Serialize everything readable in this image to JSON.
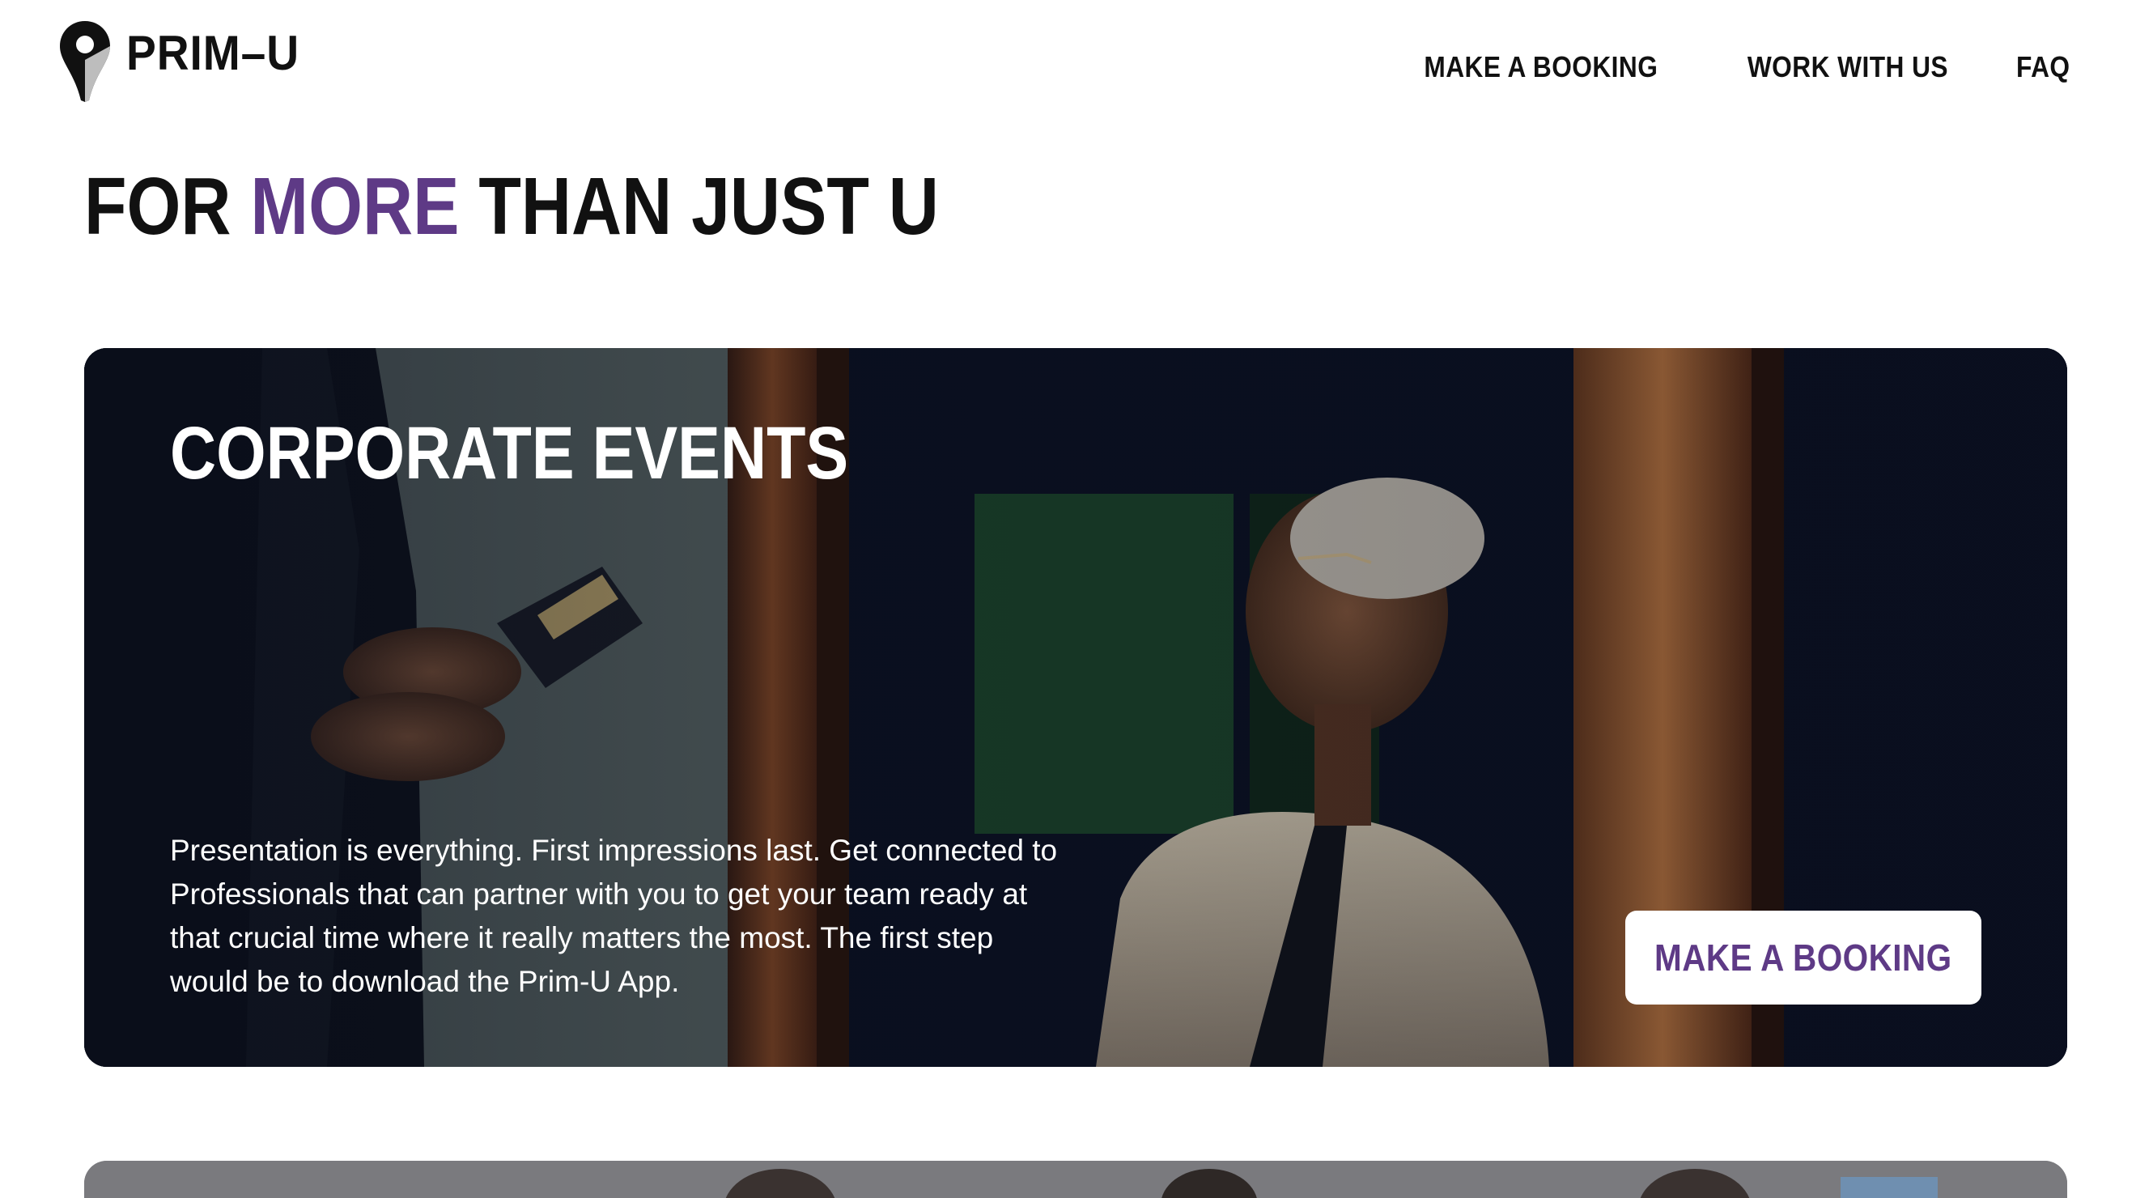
{
  "header": {
    "logo_text": "PRIM–U",
    "logo_icon": "map-pin-icon",
    "nav": [
      {
        "label": "MAKE A BOOKING"
      },
      {
        "label": "WORK WITH US"
      },
      {
        "label": "FAQ"
      }
    ]
  },
  "hero": {
    "headline_pre": "FOR ",
    "headline_accent": "MORE",
    "headline_post": " THAN JUST U"
  },
  "card": {
    "title": "CORPORATE EVENTS",
    "description": "Presentation is everything. First impressions last. Get connected to Professionals that can partner with you to get your team ready at that crucial time where it really matters the most. The first step would be to download the Prim-U App.",
    "button_label": "MAKE A BOOKING"
  },
  "colors": {
    "accent": "#5e3a86",
    "text": "#111111",
    "card_overlay": "#0b1326",
    "button_bg": "#ffffff"
  }
}
